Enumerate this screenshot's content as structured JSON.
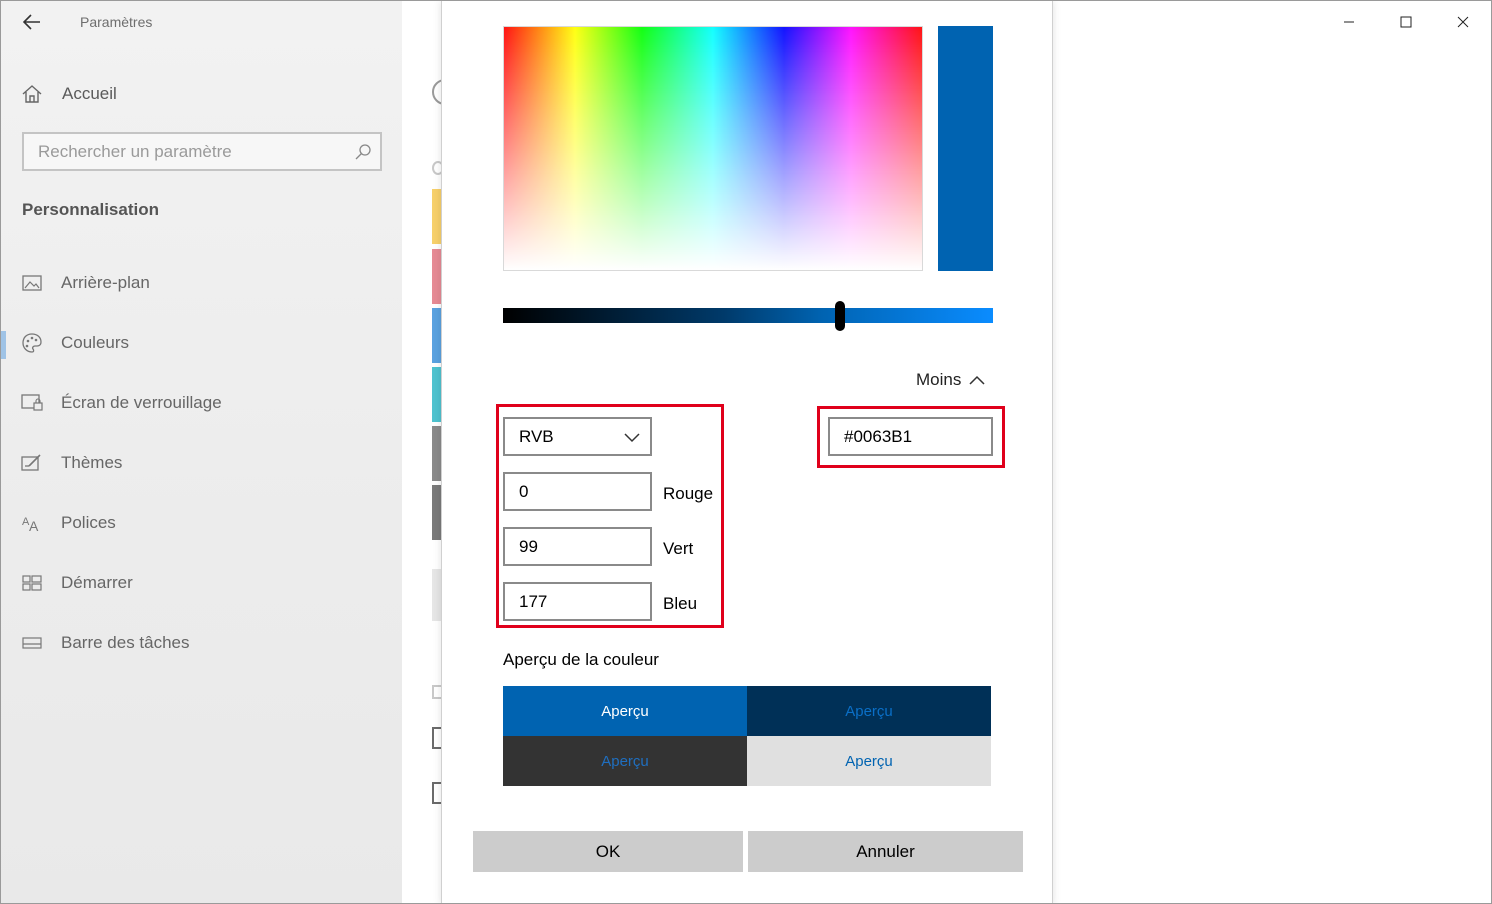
{
  "window": {
    "title": "Paramètres",
    "controls": {
      "minimize": "minimize-icon",
      "maximize": "maximize-icon",
      "close": "close-icon"
    }
  },
  "sidebar": {
    "home_label": "Accueil",
    "search_placeholder": "Rechercher un paramètre",
    "section_title": "Personnalisation",
    "items": [
      {
        "label": "Arrière-plan",
        "icon": "picture-icon",
        "active": false
      },
      {
        "label": "Couleurs",
        "icon": "palette-icon",
        "active": true
      },
      {
        "label": "Écran de verrouillage",
        "icon": "lock-screen-icon",
        "active": false
      },
      {
        "label": "Thèmes",
        "icon": "themes-icon",
        "active": false
      },
      {
        "label": "Polices",
        "icon": "fonts-icon",
        "active": false
      },
      {
        "label": "Démarrer",
        "icon": "start-icon",
        "active": false
      },
      {
        "label": "Barre des tâches",
        "icon": "taskbar-icon",
        "active": false
      }
    ]
  },
  "dialog": {
    "current_color": "#0063B1",
    "more_toggle_label": "Moins",
    "mode_select": "RVB",
    "channels": [
      {
        "value": "0",
        "label": "Rouge"
      },
      {
        "value": "99",
        "label": "Vert"
      },
      {
        "value": "177",
        "label": "Bleu"
      }
    ],
    "hex_value": "#0063B1",
    "preview_title": "Aperçu de la couleur",
    "previews": [
      {
        "label": "Aperçu",
        "bg": "#0063B1",
        "fg": "#ffffff"
      },
      {
        "label": "Aperçu",
        "bg": "#003057",
        "fg": "#0a6fc7"
      },
      {
        "label": "Aperçu",
        "bg": "#333333",
        "fg": "#1f6fc0"
      },
      {
        "label": "Aperçu",
        "bg": "#e0e0e0",
        "fg": "#0063B1"
      }
    ],
    "ok_label": "OK",
    "cancel_label": "Annuler"
  },
  "colors": {
    "highlight_border": "#e0001b",
    "accent": "#0063B1"
  }
}
